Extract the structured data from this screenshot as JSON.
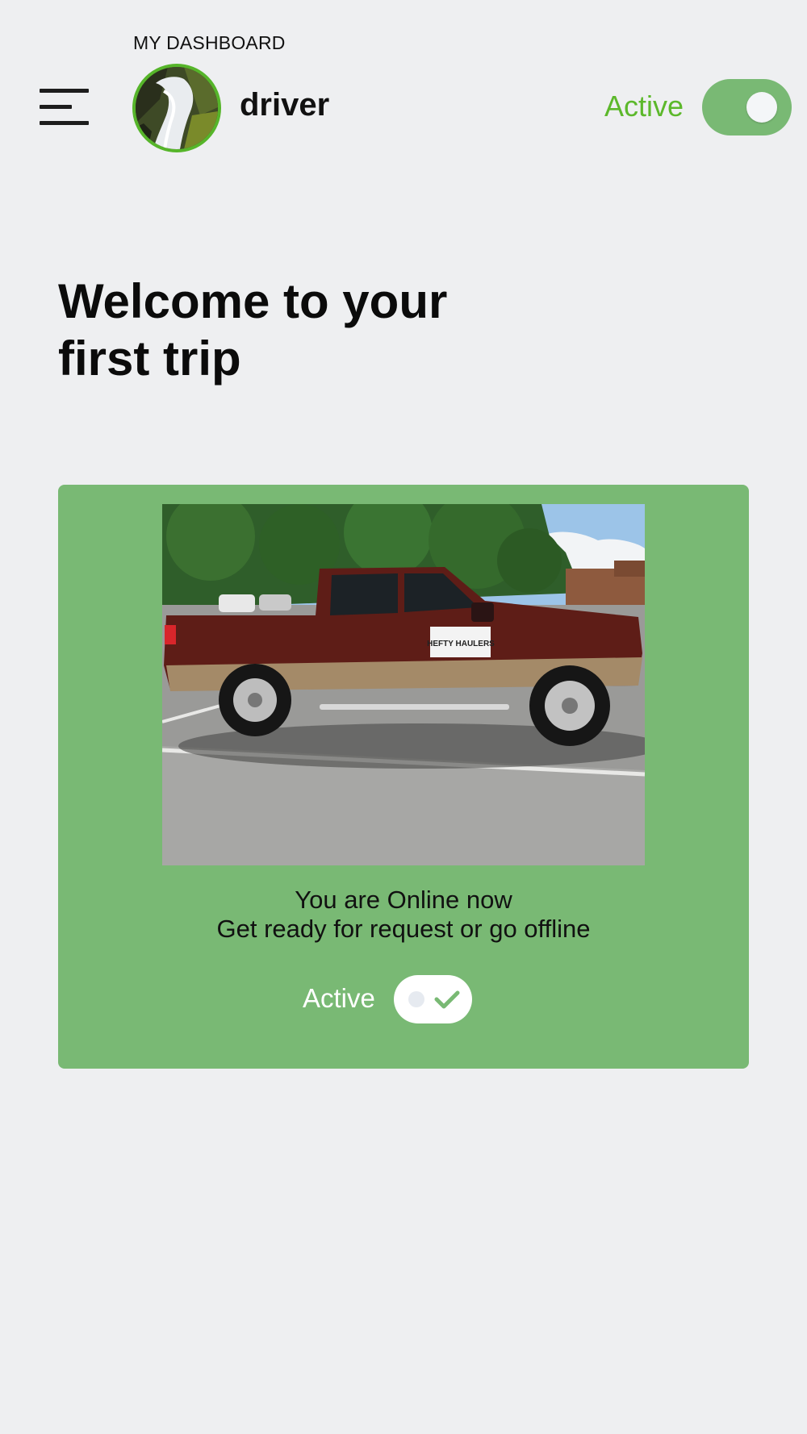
{
  "header": {
    "dashboard_label": "MY DASHBOARD",
    "username": "driver",
    "status_label": "Active",
    "status_on": true
  },
  "welcome": {
    "line1": "Welcome to your",
    "line2": "first trip"
  },
  "card": {
    "status_line1": "You are Online now",
    "status_line2": "Get ready for request or go offline",
    "toggle_label": "Active",
    "toggle_on": true,
    "vehicle_sign_text": "HEFTY HAULERS"
  },
  "colors": {
    "accent_green": "#5cb82b",
    "card_green": "#79b974",
    "background": "#eeeff1"
  },
  "icons": [
    "hamburger-menu-icon",
    "checkmark-icon"
  ]
}
